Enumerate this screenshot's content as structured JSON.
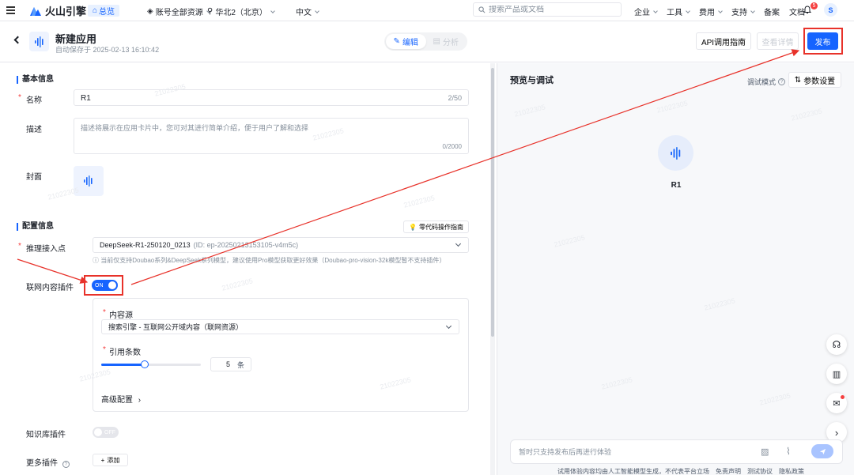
{
  "topbar": {
    "brand": "火山引擎",
    "overview": "总览",
    "account_menu": "账号全部资源",
    "region_menu": "华北2（北京）",
    "language_menu": "中文",
    "search_placeholder": "搜索产品或文档",
    "nav": [
      "企业",
      "工具",
      "费用",
      "支持",
      "备案",
      "文档"
    ],
    "notification_count": "5",
    "avatar_letter": "S"
  },
  "header": {
    "title": "新建应用",
    "autosave": "自动保存于 2025-02-13 16:10:42",
    "tab_edit": "编辑",
    "tab_analyze": "分析",
    "api_guide": "API调用指南",
    "view_details": "查看详情",
    "publish": "发布"
  },
  "basic": {
    "section_title": "基本信息",
    "name_label": "名称",
    "name_value": "R1",
    "name_count": "2/50",
    "desc_label": "描述",
    "desc_placeholder": "描述将展示在应用卡片中，您可对其进行简单介绍，便于用户了解和选择",
    "desc_count": "0/2000",
    "cover_label": "封面"
  },
  "config": {
    "section_title": "配置信息",
    "guide_button": "零代码操作指南",
    "endpoint_label": "推理接入点",
    "endpoint_value": "DeepSeek-R1-250120_0213",
    "endpoint_id": "(ID: ep-20250213153105-v4m5c)",
    "endpoint_hint": "当前仅支持Doubao系列&DeepSeek系列模型，建议使用Pro模型获取更好效果（Doubao-pro-vision-32k模型暂不支持插件）",
    "web_plugin_label": "联网内容插件",
    "web_plugin_state": "ON",
    "source_label": "内容源",
    "source_value": "搜索引擎 - 互联网公开域内容（联网资源）",
    "cite_label": "引用条数",
    "cite_value": "5",
    "cite_unit": "条",
    "cite_slider_fraction": 0.44,
    "advanced": "高级配置",
    "kb_plugin_label": "知识库插件",
    "kb_plugin_state": "OFF",
    "more_plugins_label": "更多插件",
    "add_button": "添加"
  },
  "preview": {
    "title": "预览与调试",
    "debug_mode": "调试模式",
    "param_settings": "参数设置",
    "app_name": "R1",
    "chat_placeholder": "暂时只支持发布后再进行体验",
    "footer_notice": "试用体验内容均由人工智能模型生成，不代表平台立场",
    "footer_links": [
      "免责声明",
      "测试协议",
      "隐私政策"
    ]
  },
  "watermark": "21022305",
  "colors": {
    "accent": "#1664ff",
    "annotation": "#e8322a"
  }
}
